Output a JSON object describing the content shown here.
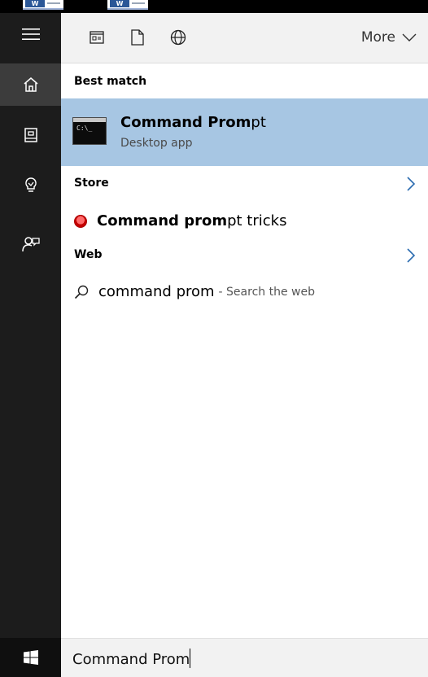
{
  "taskbar": {
    "thumb_label": "W"
  },
  "header": {
    "more_label": "More"
  },
  "results": {
    "best_match_heading": "Best match",
    "best_match": {
      "title_bold": "Command Prom",
      "title_rest": "pt",
      "subtitle": "Desktop app",
      "icon_text": "C:\\_"
    },
    "store_heading": "Store",
    "store_item": {
      "bold": "Command prom",
      "rest": "pt tricks"
    },
    "web_heading": "Web",
    "web_item": {
      "query": "command prom",
      "suffix": "- Search the web"
    }
  },
  "search": {
    "value": "Command Prom"
  },
  "icons": {
    "rail": [
      "hamburger-icon",
      "home-icon",
      "notebook-icon",
      "lightbulb-icon",
      "feedback-icon",
      "windows-start-icon"
    ],
    "header": [
      "apps-icon",
      "documents-icon",
      "web-globe-icon",
      "chevron-down-icon"
    ]
  },
  "colors": {
    "highlight": "#a7c6e3",
    "rail": "#1c1c1c",
    "header": "#f2f2f2"
  }
}
